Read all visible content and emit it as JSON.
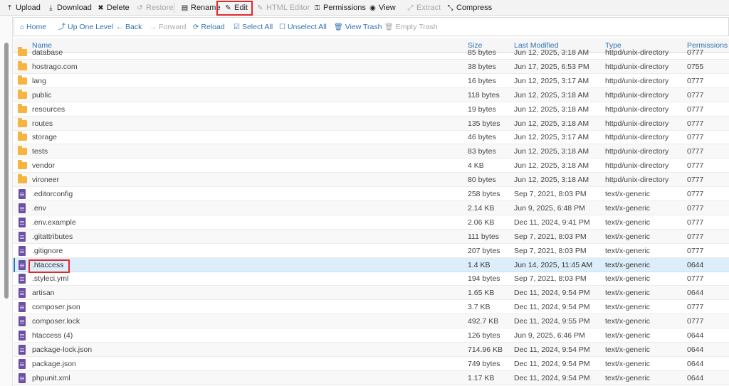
{
  "toolbar": {
    "upload": "Upload",
    "download": "Download",
    "delete": "Delete",
    "restore": "Restore",
    "rename": "Rename",
    "edit": "Edit",
    "html_editor": "HTML Editor",
    "permissions": "Permissions",
    "view": "View",
    "extract": "Extract",
    "compress": "Compress"
  },
  "nav": {
    "home": "Home",
    "up": "Up One Level",
    "back": "Back",
    "forward": "Forward",
    "reload": "Reload",
    "select_all": "Select All",
    "unselect_all": "Unselect All",
    "view_trash": "View Trash",
    "empty_trash": "Empty Trash"
  },
  "table": {
    "headers": {
      "name": "Name",
      "size": "Size",
      "modified": "Last Modified",
      "type": "Type",
      "perms": "Permissions"
    },
    "rows": [
      {
        "kind": "folder",
        "name": "database",
        "size": "85 bytes",
        "modified": "Jun 12, 2025, 3:18 AM",
        "type": "httpd/unix-directory",
        "perms": "0777"
      },
      {
        "kind": "folder",
        "name": "hostrago.com",
        "size": "38 bytes",
        "modified": "Jun 17, 2025, 6:53 PM",
        "type": "httpd/unix-directory",
        "perms": "0755"
      },
      {
        "kind": "folder",
        "name": "lang",
        "size": "16 bytes",
        "modified": "Jun 12, 2025, 3:17 AM",
        "type": "httpd/unix-directory",
        "perms": "0777"
      },
      {
        "kind": "folder",
        "name": "public",
        "size": "118 bytes",
        "modified": "Jun 12, 2025, 3:18 AM",
        "type": "httpd/unix-directory",
        "perms": "0777"
      },
      {
        "kind": "folder",
        "name": "resources",
        "size": "19 bytes",
        "modified": "Jun 12, 2025, 3:18 AM",
        "type": "httpd/unix-directory",
        "perms": "0777"
      },
      {
        "kind": "folder",
        "name": "routes",
        "size": "135 bytes",
        "modified": "Jun 12, 2025, 3:18 AM",
        "type": "httpd/unix-directory",
        "perms": "0777"
      },
      {
        "kind": "folder",
        "name": "storage",
        "size": "46 bytes",
        "modified": "Jun 12, 2025, 3:17 AM",
        "type": "httpd/unix-directory",
        "perms": "0777"
      },
      {
        "kind": "folder",
        "name": "tests",
        "size": "83 bytes",
        "modified": "Jun 12, 2025, 3:18 AM",
        "type": "httpd/unix-directory",
        "perms": "0777"
      },
      {
        "kind": "folder",
        "name": "vendor",
        "size": "4 KB",
        "modified": "Jun 12, 2025, 3:18 AM",
        "type": "httpd/unix-directory",
        "perms": "0777"
      },
      {
        "kind": "folder",
        "name": "vironeer",
        "size": "80 bytes",
        "modified": "Jun 12, 2025, 3:18 AM",
        "type": "httpd/unix-directory",
        "perms": "0777"
      },
      {
        "kind": "file",
        "name": ".editorconfig",
        "size": "258 bytes",
        "modified": "Sep 7, 2021, 8:03 PM",
        "type": "text/x-generic",
        "perms": "0777"
      },
      {
        "kind": "file",
        "name": ".env",
        "size": "2.14 KB",
        "modified": "Jun 9, 2025, 6:48 PM",
        "type": "text/x-generic",
        "perms": "0777"
      },
      {
        "kind": "file",
        "name": ".env.example",
        "size": "2.06 KB",
        "modified": "Dec 11, 2024, 9:41 PM",
        "type": "text/x-generic",
        "perms": "0777"
      },
      {
        "kind": "file",
        "name": ".gitattributes",
        "size": "111 bytes",
        "modified": "Sep 7, 2021, 8:03 PM",
        "type": "text/x-generic",
        "perms": "0777"
      },
      {
        "kind": "file",
        "name": ".gitignore",
        "size": "207 bytes",
        "modified": "Sep 7, 2021, 8:03 PM",
        "type": "text/x-generic",
        "perms": "0777"
      },
      {
        "kind": "file",
        "name": ".htaccess",
        "size": "1.4 KB",
        "modified": "Jun 14, 2025, 11:45 AM",
        "type": "text/x-generic",
        "perms": "0644",
        "selected": true
      },
      {
        "kind": "file",
        "name": ".styleci.yml",
        "size": "194 bytes",
        "modified": "Sep 7, 2021, 8:03 PM",
        "type": "text/x-generic",
        "perms": "0777"
      },
      {
        "kind": "file",
        "name": "artisan",
        "size": "1.65 KB",
        "modified": "Dec 11, 2024, 9:54 PM",
        "type": "text/x-generic",
        "perms": "0644"
      },
      {
        "kind": "file",
        "name": "composer.json",
        "size": "3.7 KB",
        "modified": "Dec 11, 2024, 9:54 PM",
        "type": "text/x-generic",
        "perms": "0777"
      },
      {
        "kind": "file",
        "name": "composer.lock",
        "size": "492.7 KB",
        "modified": "Dec 11, 2024, 9:55 PM",
        "type": "text/x-generic",
        "perms": "0777"
      },
      {
        "kind": "file",
        "name": "htaccess (4)",
        "size": "126 bytes",
        "modified": "Jun 9, 2025, 6:46 PM",
        "type": "text/x-generic",
        "perms": "0644"
      },
      {
        "kind": "file",
        "name": "package-lock.json",
        "size": "714.96 KB",
        "modified": "Dec 11, 2024, 9:54 PM",
        "type": "text/x-generic",
        "perms": "0644"
      },
      {
        "kind": "file",
        "name": "package.json",
        "size": "749 bytes",
        "modified": "Dec 11, 2024, 9:54 PM",
        "type": "text/x-generic",
        "perms": "0644"
      },
      {
        "kind": "file",
        "name": "phpunit.xml",
        "size": "1.17 KB",
        "modified": "Dec 11, 2024, 9:54 PM",
        "type": "text/x-generic",
        "perms": "0644"
      }
    ]
  }
}
